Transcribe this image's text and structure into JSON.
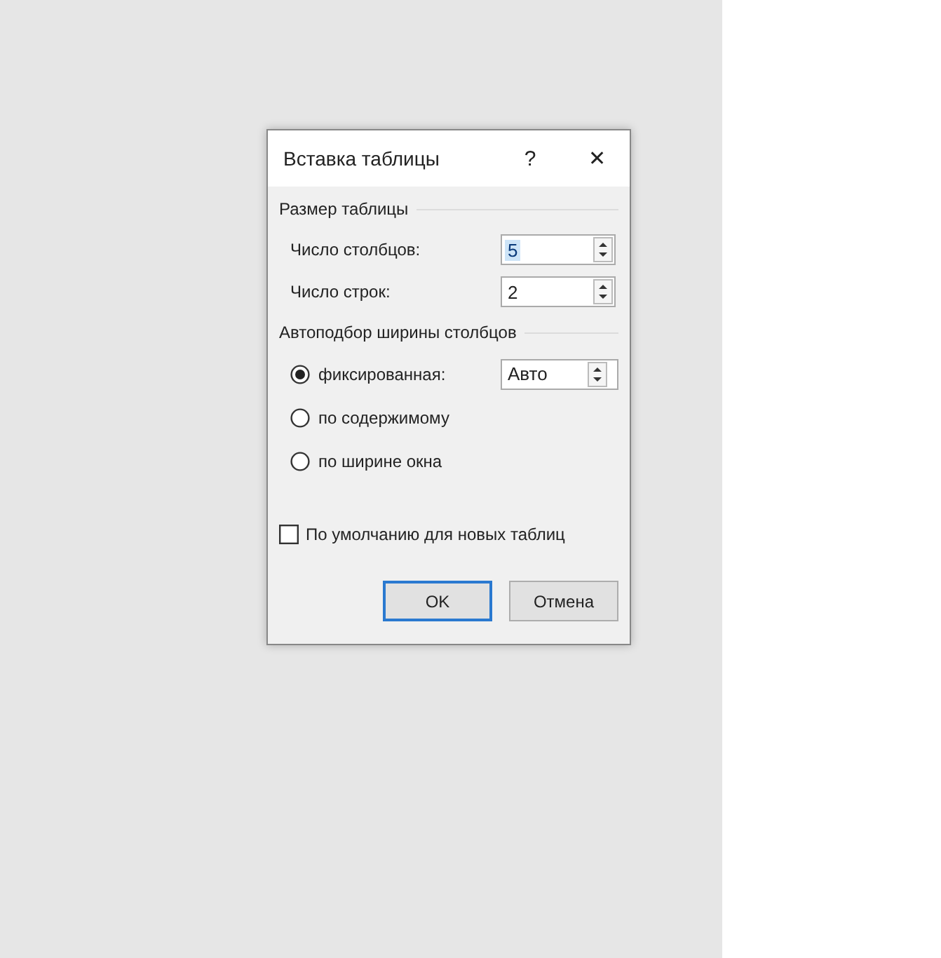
{
  "dialog": {
    "title": "Вставка таблицы",
    "help": "?",
    "close": "✕"
  },
  "size_group": {
    "title": "Размер таблицы",
    "fields": [
      {
        "label": "Число столбцов:",
        "value": "5",
        "selected_text": true
      },
      {
        "label": "Число строк:",
        "value": "2",
        "selected_text": false
      }
    ]
  },
  "autofit_group": {
    "title": "Автоподбор ширины столбцов",
    "options": [
      {
        "label": "фиксированная:",
        "selected": true,
        "value": "Авто"
      },
      {
        "label": "по содержимому",
        "selected": false
      },
      {
        "label": "по ширине окна",
        "selected": false
      }
    ]
  },
  "default_checkbox": {
    "label": "По умолчанию для новых таблиц",
    "checked": false
  },
  "buttons": [
    {
      "label": "OK",
      "kind": "default"
    },
    {
      "label": "Отмена",
      "kind": "normal"
    }
  ]
}
